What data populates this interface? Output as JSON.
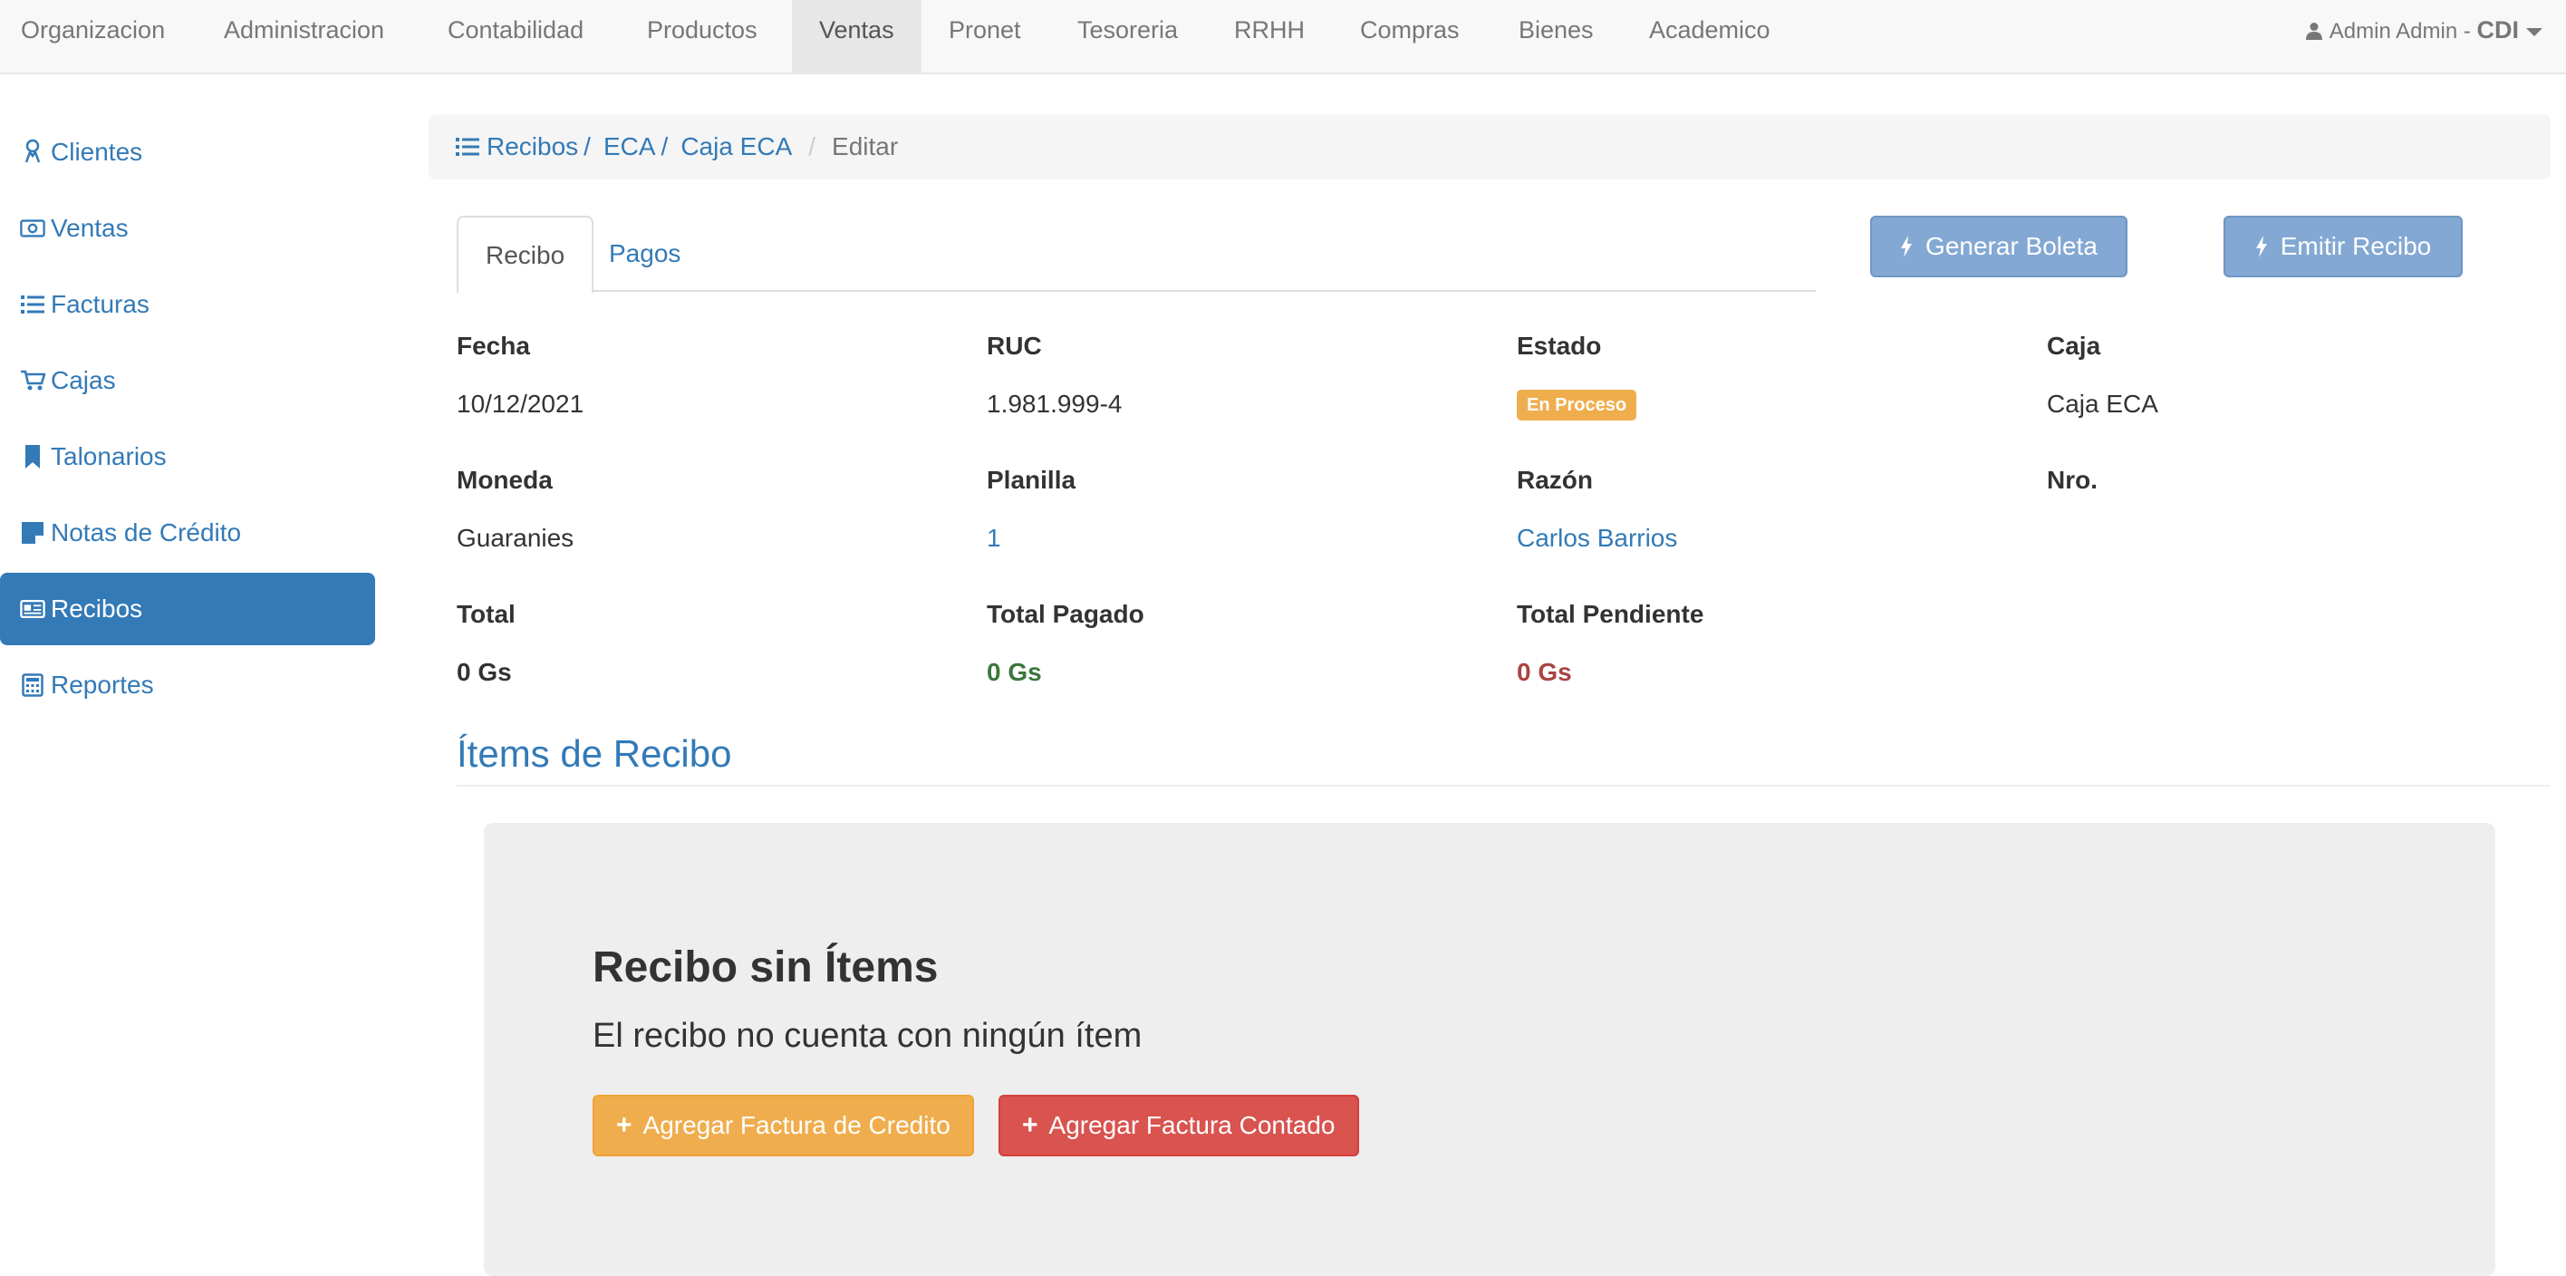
{
  "navbar": {
    "items": [
      "Organizacion",
      "Administracion",
      "Contabilidad",
      "Productos",
      "Ventas",
      "Pronet",
      "Tesoreria",
      "RRHH",
      "Compras",
      "Bienes",
      "Academico"
    ],
    "active": "Ventas",
    "user_name": "Admin Admin",
    "user_separator": " - ",
    "company": "CDI",
    "user_icon": "user-icon"
  },
  "sidebar": {
    "items": [
      {
        "label": "Clientes",
        "icon": "user-badge-icon"
      },
      {
        "label": "Ventas",
        "icon": "money-icon"
      },
      {
        "label": "Facturas",
        "icon": "list-icon"
      },
      {
        "label": "Cajas",
        "icon": "cart-icon"
      },
      {
        "label": "Talonarios",
        "icon": "bookmark-icon"
      },
      {
        "label": "Notas de Crédito",
        "icon": "sticky-note-icon"
      },
      {
        "label": "Recibos",
        "icon": "newspaper-icon"
      },
      {
        "label": "Reportes",
        "icon": "calculator-icon"
      }
    ],
    "active": "Recibos"
  },
  "breadcrumb": {
    "items": [
      "Recibos",
      "ECA",
      "Caja ECA"
    ],
    "current": "Editar"
  },
  "tabs": [
    "Recibo",
    "Pagos"
  ],
  "active_tab": "Recibo",
  "actions": {
    "generar_boleta": "Generar Boleta",
    "emitir_recibo": "Emitir Recibo"
  },
  "details": {
    "fecha": {
      "label": "Fecha",
      "value": "10/12/2021"
    },
    "ruc": {
      "label": "RUC",
      "value": "1.981.999-4"
    },
    "estado": {
      "label": "Estado",
      "value": "En Proceso"
    },
    "caja": {
      "label": "Caja",
      "value": "Caja ECA"
    },
    "moneda": {
      "label": "Moneda",
      "value": "Guaranies"
    },
    "planilla": {
      "label": "Planilla",
      "value": "1"
    },
    "razon": {
      "label": "Razón",
      "value": "Carlos Barrios"
    },
    "nro": {
      "label": "Nro.",
      "value": ""
    },
    "total": {
      "label": "Total",
      "value": "0 Gs"
    },
    "total_pagado": {
      "label": "Total Pagado",
      "value": "0 Gs"
    },
    "total_pendiente": {
      "label": "Total Pendiente",
      "value": "0 Gs"
    }
  },
  "items_section": {
    "title": "Ítems de Recibo",
    "empty_title": "Recibo sin Ítems",
    "empty_subtitle": "El recibo no cuenta con ningún ítem",
    "btn_credito": "Agregar Factura de Credito",
    "btn_contado": "Agregar Factura Contado"
  },
  "colors": {
    "primary": "#337ab7",
    "warning": "#f0ad4e",
    "danger": "#d9534f",
    "success_text": "#3c763d",
    "danger_text": "#a94442"
  }
}
